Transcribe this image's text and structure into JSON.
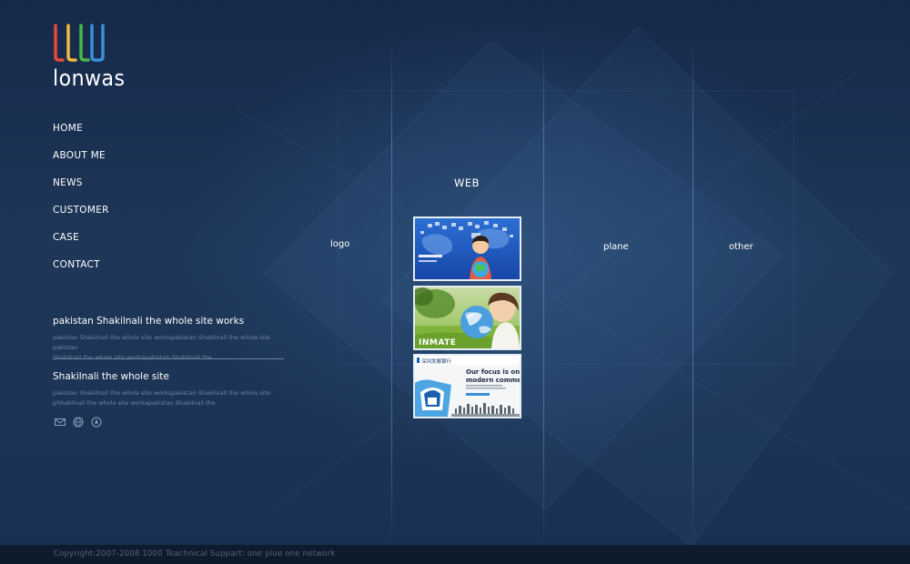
{
  "brand": {
    "name": "lonwas",
    "logo_colors": [
      "#e84a3a",
      "#f0b93a",
      "#48b84a",
      "#3a8fd8"
    ]
  },
  "nav": {
    "items": [
      {
        "label": "HOME"
      },
      {
        "label": "ABOUT ME"
      },
      {
        "label": "NEWS"
      },
      {
        "label": "CUSTOMER"
      },
      {
        "label": "CASE"
      },
      {
        "label": "CONTACT"
      }
    ]
  },
  "news": [
    {
      "title": "pakistan Shakilnali the whole site works",
      "line1": "pakistan Shakilnali the whole site workspakistan Shakilnali the whole site pakistan",
      "line2": "Shakilnali the whole site workapakistan Shakilnali the"
    },
    {
      "title": "Shakilnali the whole site",
      "line1": "pakistan Shakilnali the whole site workspakistan Shakilnali the whole site",
      "line2": "pShakilnali the whole site workapakistan Shakilnali the"
    }
  ],
  "social": {
    "icons": [
      "mail-icon",
      "globe-icon",
      "compass-icon"
    ]
  },
  "categories": {
    "web": "WEB",
    "logo": "logo",
    "plane": "plane",
    "other": "other"
  },
  "thumbnails": {
    "thumb2_text": "INMATE",
    "thumb3_text1": "Our focus is on Bu",
    "thumb3_text2": "modern commercia",
    "thumb3_brand": "深圳发展银行"
  },
  "footer": {
    "copyright": "Copyright:2007-2008 1000 Teachnical Suppart: one plue one network"
  }
}
